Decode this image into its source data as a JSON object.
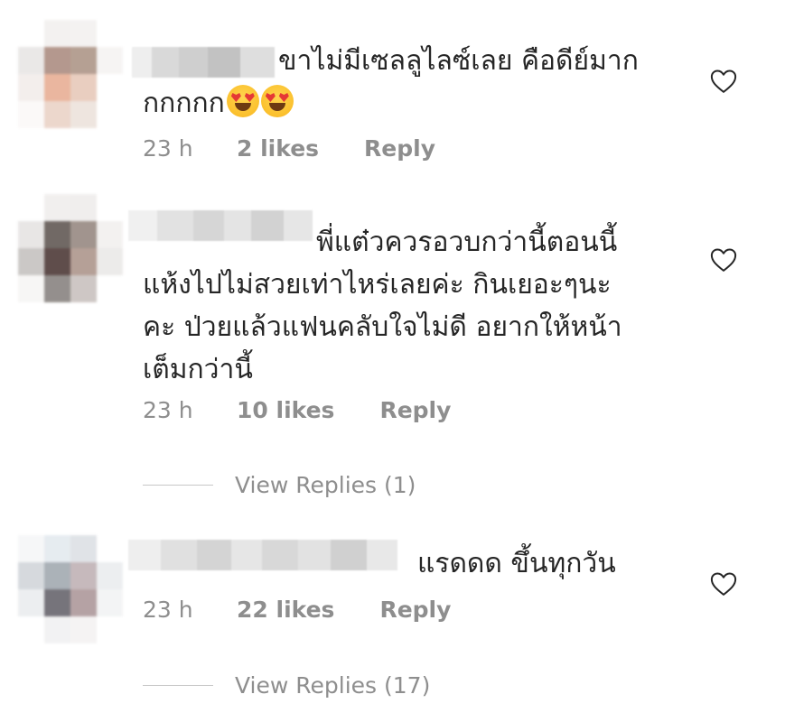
{
  "comments": [
    {
      "lines": [
        "ขาไม่มีเซลลูไลซ์เลย คือดีย์มาก",
        "กกกกก"
      ],
      "emoji_name": "heart-eyes-emoji",
      "time": "23 h",
      "likes": "2 likes",
      "reply": "Reply"
    },
    {
      "lines": [
        "พี่แต๋วควรอวบกว่านี้ตอนนี้",
        "แห้งไปไม่สวยเท่าไหร่เลยค่ะ กินเยอะๆนะ",
        "คะ ป่วยแล้วแฟนคลับใจไม่ดี อยากให้หน้า",
        "เต็มกว่านี้"
      ],
      "time": "23 h",
      "likes": "10 likes",
      "reply": "Reply",
      "view_replies": "View Replies (1)"
    },
    {
      "lines": [
        "แรดดด ขึ้นทุกวัน"
      ],
      "time": "23 h",
      "likes": "22 likes",
      "reply": "Reply",
      "view_replies": "View Replies (17)"
    }
  ],
  "icons": {
    "like": "heart-outline-icon"
  },
  "colors": {
    "text": "#262626",
    "secondary": "#8e8e8e",
    "divider": "#c7c7c7"
  }
}
